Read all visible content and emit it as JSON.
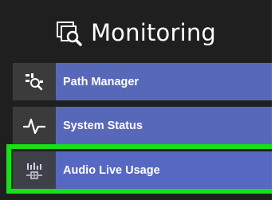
{
  "header": {
    "title": "Monitoring",
    "icon": "monitoring-search-icon"
  },
  "nav": {
    "items": [
      {
        "label": "Path Manager",
        "icon": "path-manager-icon"
      },
      {
        "label": "System Status",
        "icon": "system-status-icon"
      },
      {
        "label": "Audio Live Usage",
        "icon": "audio-live-usage-icon"
      }
    ]
  },
  "colors": {
    "background": "#1f1f1f",
    "item_label_bg": "#5868b8",
    "item_icon_bg": "#3b3b3b",
    "highlight": "#16e016",
    "text": "#ffffff"
  }
}
